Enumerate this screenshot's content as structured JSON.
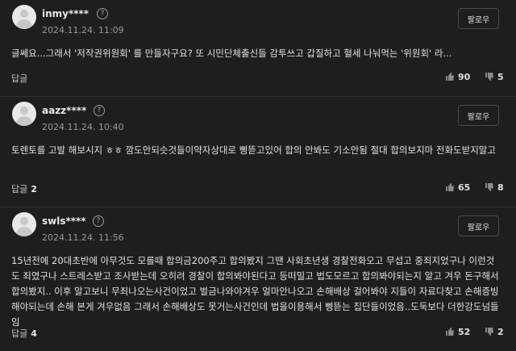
{
  "follow_label": "팔로우",
  "info_symbol": "?",
  "comments": [
    {
      "nickname": "inmy****",
      "date": "2024.11.24. 11:09",
      "text": "글쎄요...그래서 '저작권위원회' 를 만들자구요? 또 시민단체출신들 감투쓰고 갑질하고 혈세 나눠먹는 '위원회' 라...",
      "reply_label": "답글",
      "reply_count": "",
      "likes": "90",
      "dislikes": "5"
    },
    {
      "nickname": "aazz****",
      "date": "2024.11.24. 10:40",
      "text": "토렌토를 고발 해보시지 ㅎㅎ 깜도안되슷것들이약자상대로 삥뜯고있어 합의 안봐도 기소안됨 절대 합의보지마 전화도받지말고",
      "reply_label": "답글",
      "reply_count": "2",
      "likes": "65",
      "dislikes": "8"
    },
    {
      "nickname": "swls****",
      "date": "2024.11.24. 11:56",
      "text": "15년전에 20대초반에 아무것도 모를때 합의금200주고 합의봤지 그땐 사회초년생 경찰전화오고 무섭고 중죄지었구나 이런것도 죄였구나 스트레스받고 조사받는데 오히려 경찰이 합의봐야된다고 등떠밀고 법도모르고 합의봐야되는지 알고 겨우 돈구해서 합의봤지.. 이후 알고보니 무죄나오는사건이었고 벌금나와야겨우 얼마안나오고 손해배상 걸어봐야 지들이 자료다찾고 손해증빙해야되는데 손해 본게 겨우없음 그래서 손해배상도 못거는사건인데 법을이용해서 삥뜯는 집단들이었음..도둑보다 더한강도넘들임",
      "reply_label": "답글",
      "reply_count": "4",
      "likes": "52",
      "dislikes": "2"
    }
  ]
}
